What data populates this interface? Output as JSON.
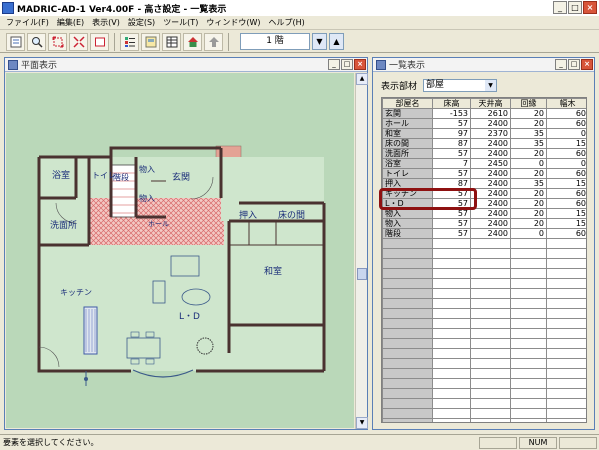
{
  "app": {
    "title": "MADRIC-AD-1 Ver4.00F - 高さ設定 - 一覧表示"
  },
  "menu": [
    "ファイル(F)",
    "編集(E)",
    "表示(V)",
    "設定(S)",
    "ツール(T)",
    "ウィンドウ(W)",
    "ヘルプ(H)"
  ],
  "toolbar": {
    "icons": [
      "new-icon",
      "search-icon",
      "fit-icon",
      "zoom-icon",
      "frame-icon",
      "list-icon",
      "layout-icon",
      "table-icon",
      "house-icon",
      "up-icon"
    ],
    "floor_value": "1 階",
    "floor_down": "▼",
    "floor_up": "▲"
  },
  "plan_window": {
    "title": "平面表示",
    "rooms": {
      "bath": "浴室",
      "toilet": "トイレ",
      "stairs": "階段",
      "storage": "物入",
      "entrance": "玄関",
      "washroom": "洗面所",
      "hall": "ホール",
      "closet": "押入",
      "alcove": "床の間",
      "tatami": "和室",
      "kitchen": "キッチン",
      "living": "L・D"
    }
  },
  "list_window": {
    "title": "一覧表示",
    "filter_label": "表示部材",
    "filter_value": "部屋",
    "columns": [
      "部屋名",
      "床高",
      "天井高",
      "回縁",
      "幅木"
    ],
    "rows": [
      [
        "玄関",
        "-153",
        "2610",
        "20",
        "60"
      ],
      [
        "ホール",
        "57",
        "2400",
        "20",
        "60"
      ],
      [
        "和室",
        "97",
        "2370",
        "35",
        "0"
      ],
      [
        "床の間",
        "87",
        "2400",
        "35",
        "15"
      ],
      [
        "洗面所",
        "57",
        "2400",
        "20",
        "60"
      ],
      [
        "浴室",
        "7",
        "2450",
        "0",
        "0"
      ],
      [
        "トイレ",
        "57",
        "2400",
        "20",
        "60"
      ],
      [
        "押入",
        "87",
        "2400",
        "35",
        "15"
      ],
      [
        "キッチン",
        "57",
        "2400",
        "20",
        "60"
      ],
      [
        "L・D",
        "57",
        "2400",
        "20",
        "60"
      ],
      [
        "物入",
        "57",
        "2400",
        "20",
        "15"
      ],
      [
        "物入",
        "57",
        "2400",
        "20",
        "15"
      ],
      [
        "階段",
        "57",
        "2400",
        "0",
        "60"
      ]
    ],
    "empty_rows": 21
  },
  "status": {
    "message": "要素を選択してください。",
    "num": "NUM"
  },
  "colors": {
    "plan_background": "#bad8b9",
    "hall_hatch": "#d86a6a",
    "entrance_step": "#e4a395",
    "highlight": "#8e1111"
  }
}
